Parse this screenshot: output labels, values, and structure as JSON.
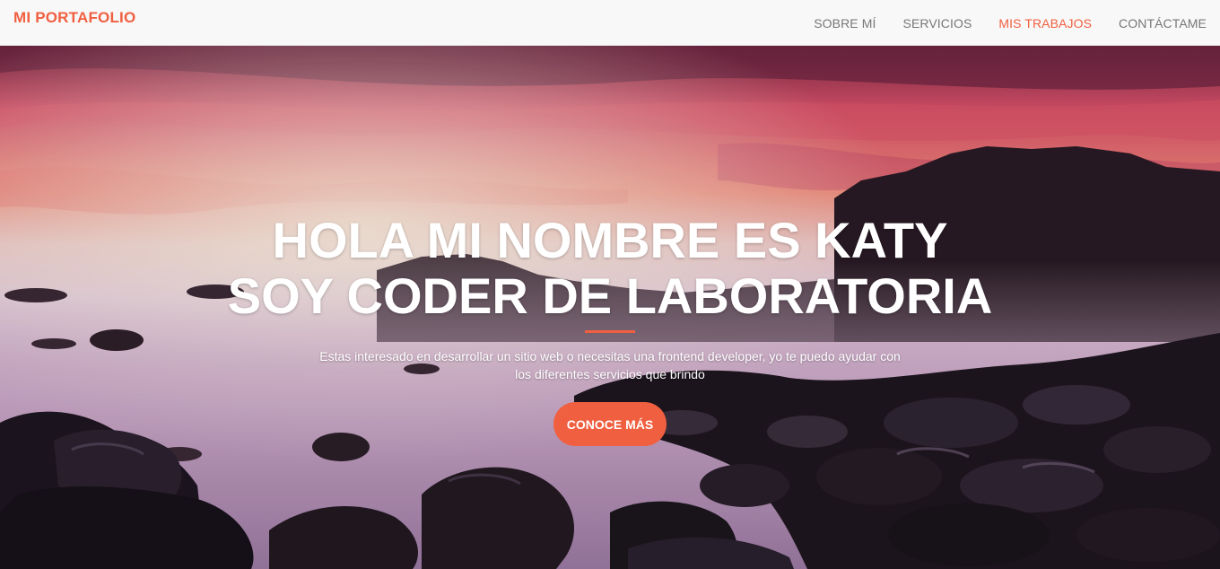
{
  "navbar": {
    "brand": "MI PORTAFOLIO",
    "links": [
      {
        "label": "SOBRE MÍ",
        "active": false
      },
      {
        "label": "SERVICIOS",
        "active": false
      },
      {
        "label": "MIS TRABAJOS",
        "active": true
      },
      {
        "label": "CONTÁCTAME",
        "active": false
      }
    ]
  },
  "hero": {
    "title_line1": "HOLA MI NOMBRE ES KATY",
    "title_line2": "SOY CODER DE LABORATORIA",
    "text": "Estas interesado en desarrollar un sitio web o necesitas una frontend developer, yo te puedo ayudar con los diferentes servicios que brindo",
    "button_label": "CONOCE MÁS"
  },
  "colors": {
    "accent": "#f05f40",
    "nav_background": "#f8f8f8",
    "nav_text": "#777777"
  }
}
